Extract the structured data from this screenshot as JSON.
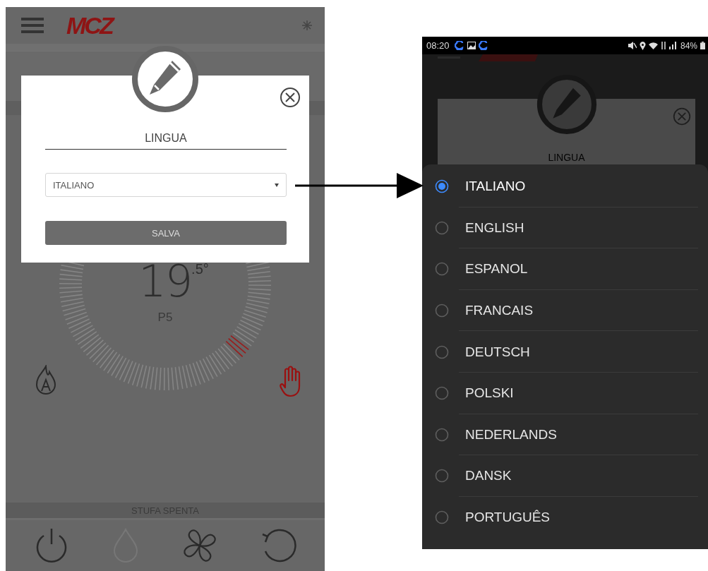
{
  "left_screen": {
    "logo": "MCZ",
    "dialog": {
      "title": "LINGUA",
      "select_value": "ITALIANO",
      "save_button": "SALVA"
    },
    "thermostat": {
      "temperature": "19",
      "decimal": ".5°",
      "power_level": "P5"
    },
    "status": "STUFA SPENTA"
  },
  "right_screen": {
    "status_bar": {
      "time": "08:20",
      "battery": "84%"
    },
    "background_dialog_title": "LINGUA",
    "language_options": [
      {
        "label": "ITALIANO",
        "selected": true
      },
      {
        "label": "ENGLISH",
        "selected": false
      },
      {
        "label": "ESPANOL",
        "selected": false
      },
      {
        "label": "FRANCAIS",
        "selected": false
      },
      {
        "label": "DEUTSCH",
        "selected": false
      },
      {
        "label": "POLSKI",
        "selected": false
      },
      {
        "label": "NEDERLANDS",
        "selected": false
      },
      {
        "label": "DANSK",
        "selected": false
      },
      {
        "label": "PORTUGUÊS",
        "selected": false
      }
    ]
  }
}
